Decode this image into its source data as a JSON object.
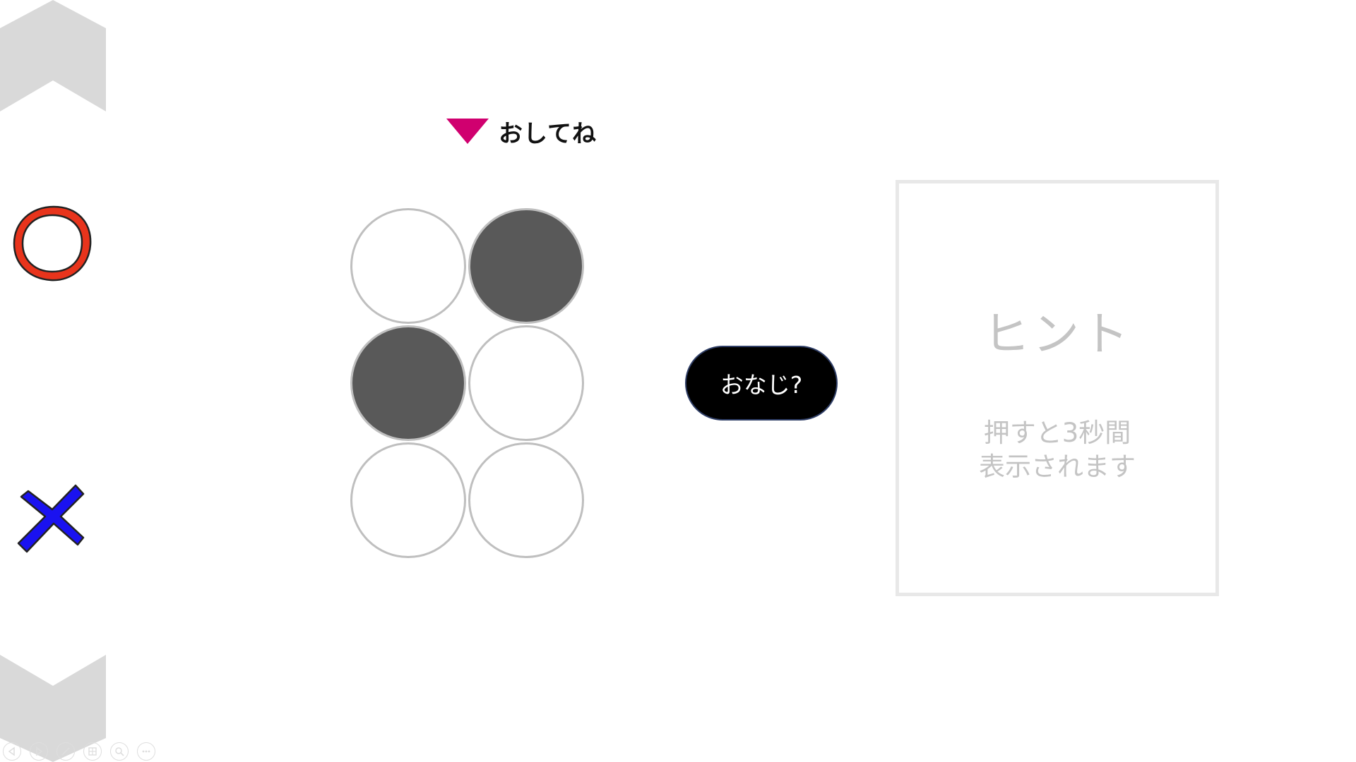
{
  "press_hint": {
    "label": "おしてね",
    "arrow_color": "#d0006f"
  },
  "dot_grid": {
    "filled_color": "#595959",
    "outline_color": "#bfbfbf",
    "cells": [
      {
        "label": "dot-1",
        "filled": false
      },
      {
        "label": "dot-4",
        "filled": true
      },
      {
        "label": "dot-2",
        "filled": true
      },
      {
        "label": "dot-5",
        "filled": false
      },
      {
        "label": "dot-3",
        "filled": false
      },
      {
        "label": "dot-6",
        "filled": false
      }
    ]
  },
  "same_button": {
    "label": "おなじ?"
  },
  "hint_panel": {
    "title": "ヒント",
    "desc_line1": "押すと3秒間",
    "desc_line2": "表示されます"
  },
  "marks": {
    "correct_icon": "red-circle-icon",
    "correct_color": "#e8341c",
    "wrong_icon": "blue-cross-icon",
    "wrong_color": "#1a12f0"
  },
  "navigation": {
    "up_icon": "chevron-up-icon",
    "down_icon": "chevron-down-icon",
    "color": "#d9d9d9"
  },
  "toolbar": {
    "buttons": [
      "previous-icon",
      "next-icon",
      "pen-icon",
      "slides-icon",
      "zoom-icon",
      "more-icon"
    ]
  }
}
